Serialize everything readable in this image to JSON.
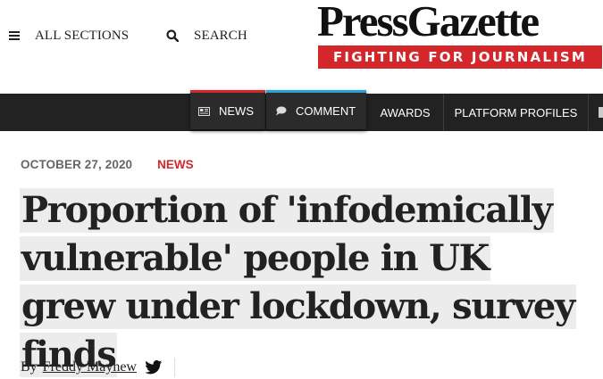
{
  "header": {
    "menu_label": "ALL SECTIONS",
    "search_label": "SEARCH",
    "logo_text": "PressGazette",
    "tagline": "FIGHTING FOR JOURNALISM"
  },
  "nav": {
    "items": [
      {
        "label": "NEWS",
        "icon": "newspaper-icon",
        "accent": "#d4272c"
      },
      {
        "label": "COMMENT",
        "icon": "speech-bubble-icon",
        "accent": "#2e9fd8"
      },
      {
        "label": "AWARDS"
      },
      {
        "label": "PLATFORM PROFILES"
      }
    ]
  },
  "article": {
    "date": "OCTOBER 27, 2020",
    "category": "NEWS",
    "headline": "Proportion of 'infodemically vulnerable' people in UK grew under lockdown, survey finds",
    "byline_prefix": "By",
    "author": "Freddy Mayhew",
    "author_social_icon": "twitter-icon"
  },
  "colors": {
    "brand_red": "#d4272c",
    "comment_blue": "#2e9fd8",
    "nav_bg": "#222222",
    "headline_highlight": "#ececec"
  }
}
